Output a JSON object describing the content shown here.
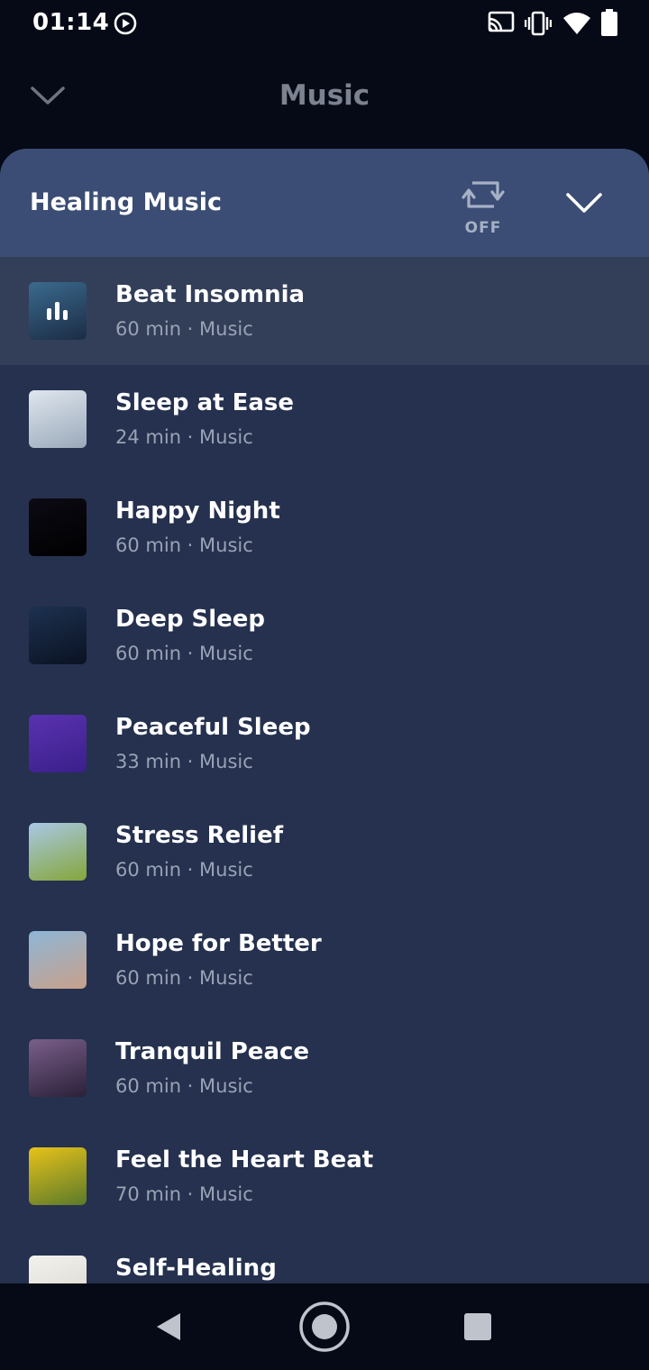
{
  "status_bar": {
    "time": "01:14",
    "icons": [
      "play-circle-icon",
      "cast-icon",
      "vibrate-icon",
      "wifi-icon",
      "battery-icon"
    ]
  },
  "header": {
    "title": "Music",
    "back_icon": "chevron-down-icon"
  },
  "sheet": {
    "title": "Healing Music",
    "repeat": {
      "icon": "repeat-icon",
      "label": "OFF"
    },
    "collapse_icon": "chevron-down-icon",
    "tracks": [
      {
        "title": "Beat Insomnia",
        "meta": "60 min · Music",
        "active": true,
        "thumb": [
          "#3b6a8e",
          "#1b2c44"
        ]
      },
      {
        "title": "Sleep at Ease",
        "meta": "24 min · Music",
        "active": false,
        "thumb": [
          "#dfe6ee",
          "#9aa9ba"
        ]
      },
      {
        "title": "Happy Night",
        "meta": "60 min · Music",
        "active": false,
        "thumb": [
          "#0c0a14",
          "#000000"
        ]
      },
      {
        "title": "Deep Sleep",
        "meta": "60 min · Music",
        "active": false,
        "thumb": [
          "#1d3150",
          "#0a1222"
        ]
      },
      {
        "title": "Peaceful Sleep",
        "meta": "33 min · Music",
        "active": false,
        "thumb": [
          "#5a32b0",
          "#3a1f8a"
        ]
      },
      {
        "title": "Stress Relief",
        "meta": "60 min · Music",
        "active": false,
        "thumb": [
          "#a8c8e6",
          "#86a63a"
        ]
      },
      {
        "title": "Hope for Better",
        "meta": "60 min · Music",
        "active": false,
        "thumb": [
          "#8eb6d6",
          "#c8a08a"
        ]
      },
      {
        "title": "Tranquil Peace",
        "meta": "60 min · Music",
        "active": false,
        "thumb": [
          "#7a5f8a",
          "#2a2038"
        ]
      },
      {
        "title": "Feel the Heart Beat",
        "meta": "70 min · Music",
        "active": false,
        "thumb": [
          "#e8c21a",
          "#5a7a2a"
        ]
      },
      {
        "title": "Self-Healing",
        "meta": "",
        "active": false,
        "thumb": [
          "#f2f2ee",
          "#d8d4cc"
        ]
      }
    ]
  },
  "nav_bar": {
    "icons": [
      "back-triangle-icon",
      "home-circle-icon",
      "recents-square-icon"
    ]
  },
  "colors": {
    "background": "#050a16",
    "sheet": "#25314e",
    "sheet_header": "#3b4d74",
    "active_row": "#333f59"
  }
}
